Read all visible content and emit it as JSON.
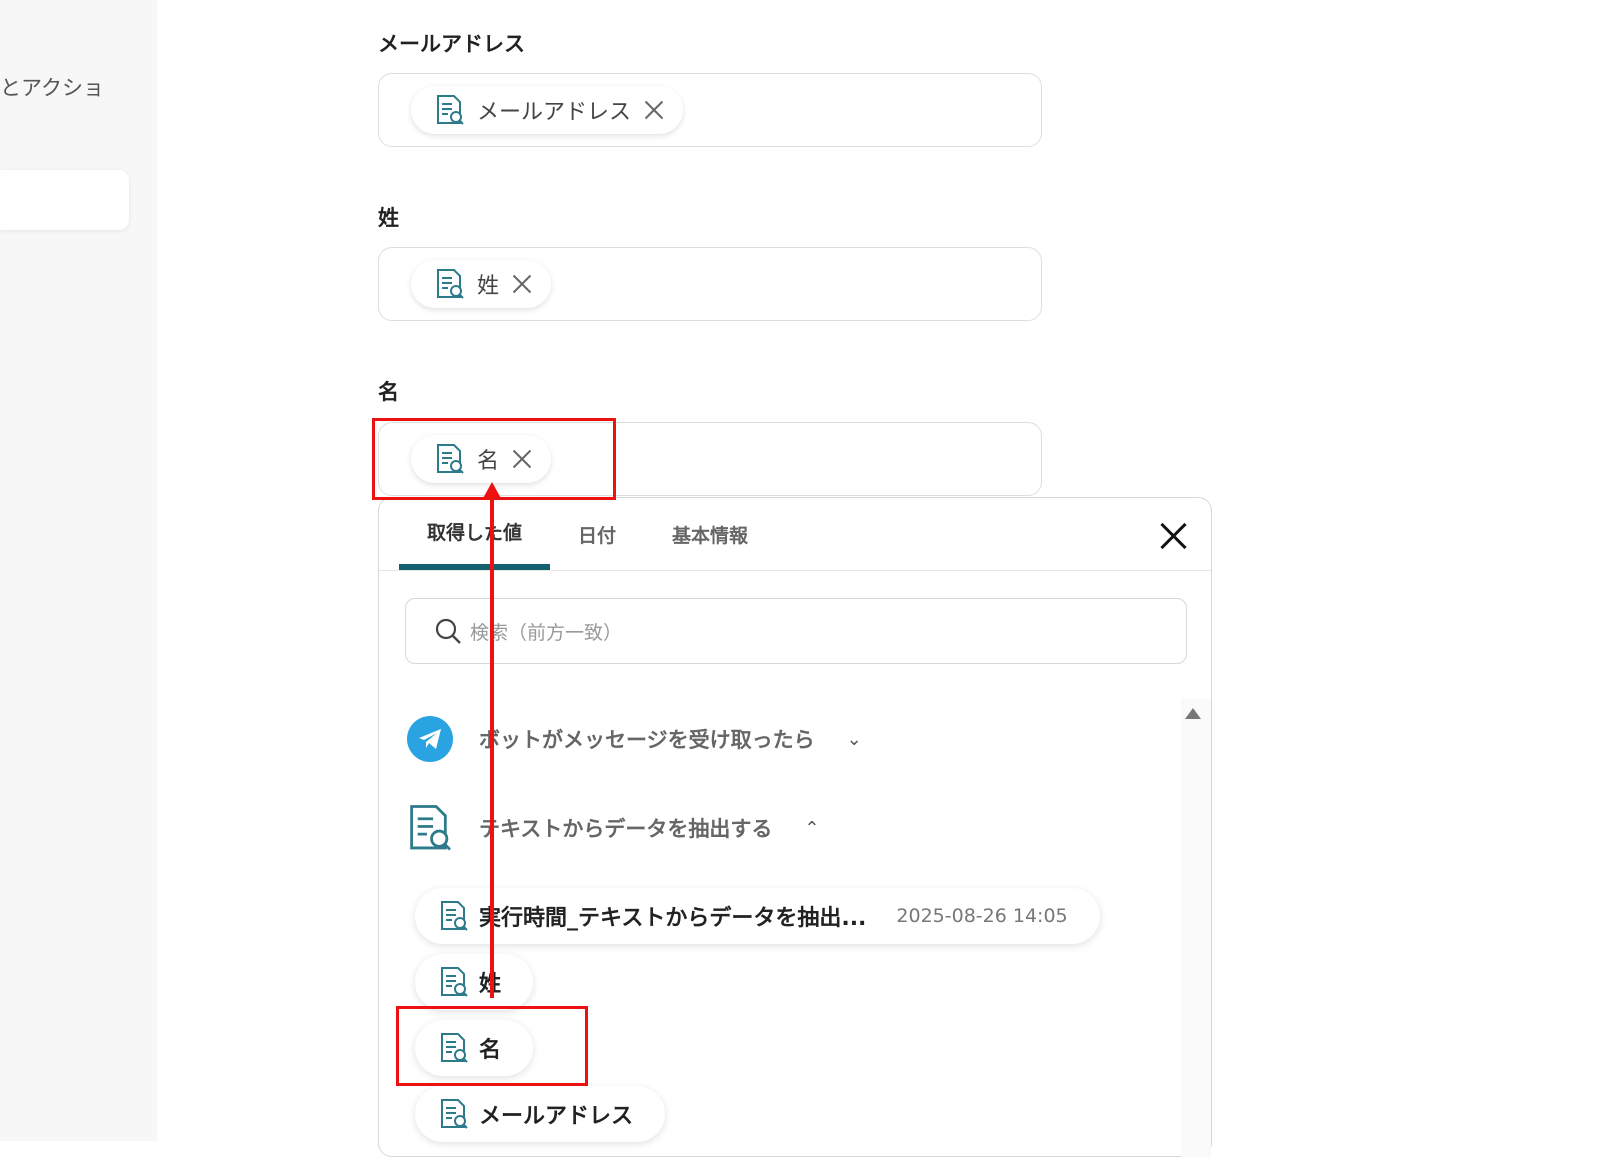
{
  "sidebar": {
    "partial_text": "とアクショ"
  },
  "fields": [
    {
      "label": "メールアドレス",
      "chip": "メールアドレス"
    },
    {
      "label": "姓",
      "chip": "姓"
    },
    {
      "label": "名",
      "chip": "名"
    }
  ],
  "panel": {
    "tabs": [
      "取得した値",
      "日付",
      "基本情報"
    ],
    "active_tab": "取得した値",
    "search_placeholder": "検索（前方一致）",
    "groups": [
      {
        "label": "ボットがメッセージを受け取ったら",
        "expanded": false,
        "icon": "telegram-icon"
      },
      {
        "label": "テキストからデータを抽出する",
        "expanded": true,
        "icon": "document-search-icon"
      }
    ],
    "items": [
      {
        "label": "実行時間_テキストからデータを抽出...",
        "time": "2025-08-26 14:05"
      },
      {
        "label": "姓",
        "time": ""
      },
      {
        "label": "名",
        "time": ""
      },
      {
        "label": "メールアドレス",
        "time": ""
      }
    ]
  },
  "colors": {
    "accent_tab": "#15606e",
    "annotation_red": "#ee1111",
    "telegram_blue": "#2aa3e2",
    "icon_teal": "#2c7a8a"
  }
}
